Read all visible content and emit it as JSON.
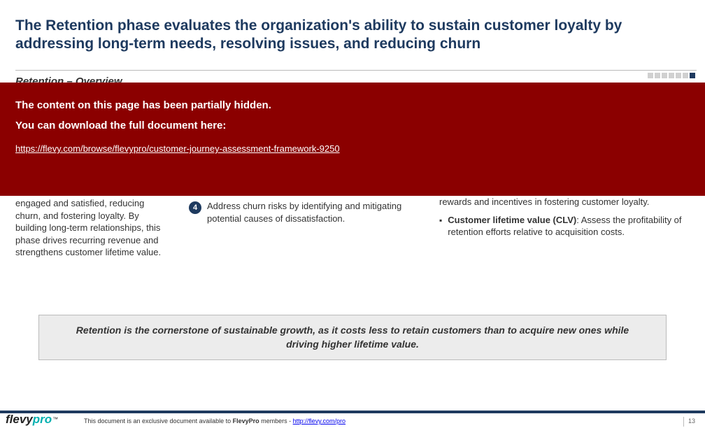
{
  "header": {
    "title": "The Retention phase evaluates the organization's ability to sustain customer loyalty by addressing long-term needs, resolving issues, and reducing churn",
    "subtitle": "Retention – Overview"
  },
  "progress": {
    "total": 7,
    "active_index": 6
  },
  "overlay": {
    "line1": "The content on this page has been partially hidden.",
    "line2": "You can download the full document here:",
    "link_text": "https://flevy.com/browse/flevypro/customer-journey-assessment-framework-9250"
  },
  "left_col": {
    "text": "engaged and satisfied, reducing churn, and fostering loyalty. By building long-term relationships, this phase drives recurring revenue and strengthens customer lifetime value."
  },
  "mid_col": {
    "steps": [
      {
        "num": "4",
        "text": "Address churn risks by identifying and mitigating potential causes of dissatisfaction."
      }
    ]
  },
  "right_col": {
    "bullets": [
      {
        "bold": "",
        "tail": "rewards and incentives in fostering customer loyalty."
      },
      {
        "bold": "Customer lifetime value (CLV)",
        "tail": ": Assess the profitability of retention efforts relative to acquisition costs."
      }
    ]
  },
  "callout": {
    "text": "Retention is the cornerstone of sustainable growth, as it costs less to retain customers than to acquire new ones while driving higher lifetime value."
  },
  "footer": {
    "logo_main": "flevy",
    "logo_accent": "pro",
    "logo_tm": "™",
    "text_prefix": "This document is an exclusive document available to ",
    "text_bold": "FlevyPro",
    "text_suffix": " members - ",
    "link": "http://flevy.com/pro",
    "page": "13"
  }
}
